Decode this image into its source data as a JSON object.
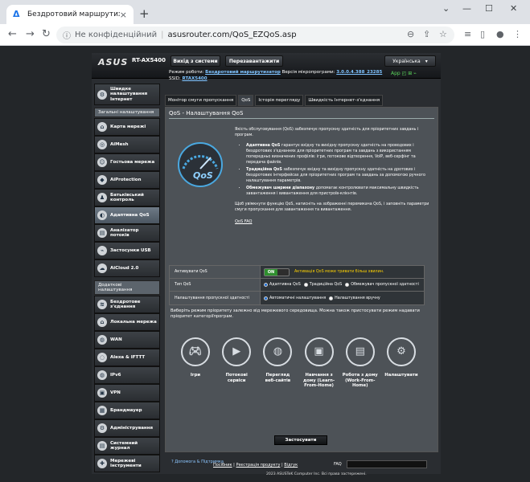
{
  "browser": {
    "tab_title": "Бездротовий маршрутизатор AS",
    "close_glyph": "×",
    "new_tab": "+",
    "url_not_secure": "Не конфіденційний",
    "url": "asusrouter.com/QoS_EZQoS.asp"
  },
  "header": {
    "logo": "ASUS",
    "model": "RT-AX5400",
    "logout": "Вихід з системи",
    "reboot": "Перезавантажити",
    "language": "Українська",
    "mode_label": "Режим роботи:",
    "mode_value": "Бездротовий маршрутизатор",
    "fw_label": "Версія мікропрограми:",
    "fw_value": "3.0.0.4.388_23285",
    "ssid_label": "SSID:",
    "ssid_value": "RTAX5400",
    "app_label": "App"
  },
  "sidebar": {
    "quick": "Швидке налаштування Інтернет",
    "general_head": "Загальні налаштування",
    "general": [
      "Карта мережі",
      "AiMesh",
      "Гостьова мережа",
      "AiProtection",
      "Батьківський контроль",
      "Адаптивна QoS",
      "Аналізатор потоків",
      "Застосунки USB",
      "AiCloud 2.0"
    ],
    "advanced_head": "Додаткові налаштування",
    "advanced": [
      "Бездротове з'єднання",
      "Локальна мережа",
      "WAN",
      "Alexa & IFTTT",
      "IPv6",
      "VPN",
      "Брандмауер",
      "Адміністрування",
      "Системний журнал",
      "Мережеві інструменти"
    ]
  },
  "tabs": [
    "Монітор смуги пропускання",
    "QoS",
    "Історія перегляду",
    "Швидкість Інтернет-з'єднання"
  ],
  "panel": {
    "title": "QoS - Налаштування QoS",
    "intro": "Якість обслуговування (QoS) забезпечує пропускну здатність для пріоритетних завдань і програм.",
    "b1_title": "Адаптивна QoS",
    "b1_text": " гарантує вхідну та вихідну пропускну здатність на проводових і бездротових з'єднаннях для пріоритетних програм та завдань з використанням попередньо визначених профілів: ігри, потокове відтворення, VoIP, веб-серфінг та передача файлів.",
    "b2_title": "Традиційна QoS",
    "b2_text": " забезпечує вхідну та вихідну пропускну здатність на дротових і бездротових інтерфейсах для пріоритетних програм та завдань за допомогою ручного налаштування параметрів.",
    "b3_title": "Обмежувач ширини діапазону",
    "b3_text": " допомагає контролювати максимальну швидкість завантаження і вивантаження для пристроїв-клієнтів.",
    "outro": "Щоб увімкнути функцію QoS, натисніть на зображенні перемикача QoS, і заповніть параметри смуги пропускання для завантаження та вивантаження.",
    "faq": "QoS FAQ"
  },
  "settings": {
    "enable_label": "Активувати QoS",
    "toggle_on": "ON",
    "enable_note": "Активація QoS може тривати більш хвилин.",
    "type_label": "Тип QoS",
    "type_options": [
      "Адаптивна QoS",
      "Традиційна QoS",
      "Обмежувач пропускної здатності"
    ],
    "bw_label": "Налаштування пропускної здатності",
    "bw_options": [
      "Автоматичні налаштування",
      "Налаштування вручну"
    ]
  },
  "hint": "Виберіть режим пріоритету залежно від мережевого середовища. Можна також пристосувати режим надавати пріоритет категоріїпрограм.",
  "modes": [
    "Ігри",
    "Потокові сервіси",
    "Перегляд веб-сайтів",
    "Навчання з дому (Learn-From-Home)",
    "Робота з дому (Work-From-Home)",
    "Налаштувати"
  ],
  "apply": "Застосувати",
  "footer": {
    "help": "Допомога & Підтримка",
    "links": [
      "Посібник",
      "Реєстрація продукту",
      "Відгук"
    ],
    "faq": "FAQ",
    "copyright": "2023 ASUSTeK Computer Inc. Всі права застережені."
  }
}
